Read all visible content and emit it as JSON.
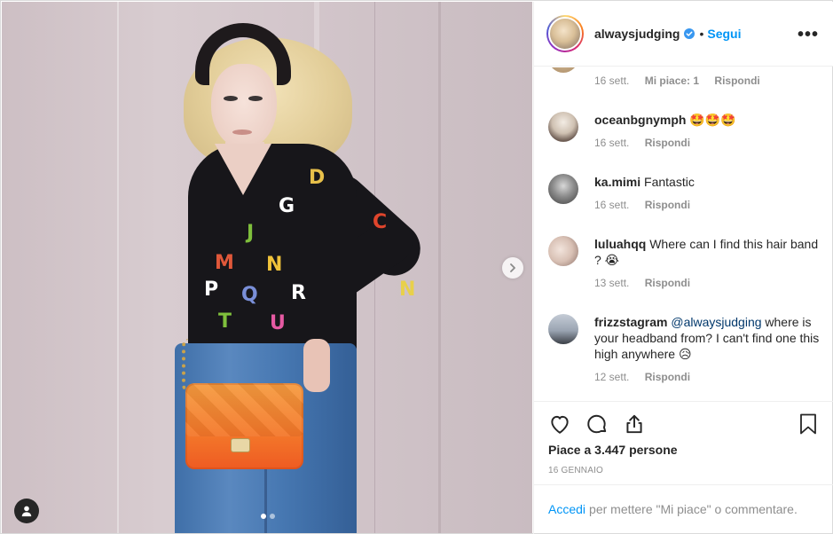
{
  "post": {
    "photo_carousel": {
      "slides": 2,
      "active_slide": 1
    }
  },
  "header": {
    "username": "alwaysjudging",
    "separator": "•",
    "follow_label": "Segui",
    "more_label": "•••"
  },
  "comments": [
    {
      "user": "",
      "text": "",
      "time": "16 sett.",
      "likes": "Mi piace: 1",
      "reply": "Rispondi"
    },
    {
      "user": "oceanbgnymph",
      "text": "🤩🤩🤩",
      "time": "16 sett.",
      "reply": "Rispondi"
    },
    {
      "user": "ka.mimi",
      "text": "Fantastic",
      "time": "16 sett.",
      "reply": "Rispondi"
    },
    {
      "user": "luluahqq",
      "text": "Where can I find this hair band ? 😭",
      "time": "13 sett.",
      "reply": "Rispondi"
    },
    {
      "user": "frizzstagram",
      "mention": "@alwaysjudging",
      "text": " where is your headband from? I can't find one this high anywhere 😥",
      "time": "12 sett.",
      "reply": "Rispondi"
    }
  ],
  "actions": {
    "likes_text": "Piace a 3.447 persone",
    "date": "16 GENNAIO"
  },
  "login": {
    "link": "Accedi",
    "text": "per mettere \"Mi piace\" o commentare."
  },
  "icons": {
    "verified": "verified-badge-icon",
    "more": "more-options-icon",
    "like": "heart-icon",
    "comment": "comment-bubble-icon",
    "share": "share-icon",
    "save": "bookmark-icon",
    "next": "chevron-right-icon",
    "tag": "user-tag-icon"
  },
  "colors": {
    "brand_blue": "#0095f6",
    "mention": "#00376b",
    "muted": "#8e8e8e",
    "text": "#262626",
    "border": "#efefef"
  }
}
